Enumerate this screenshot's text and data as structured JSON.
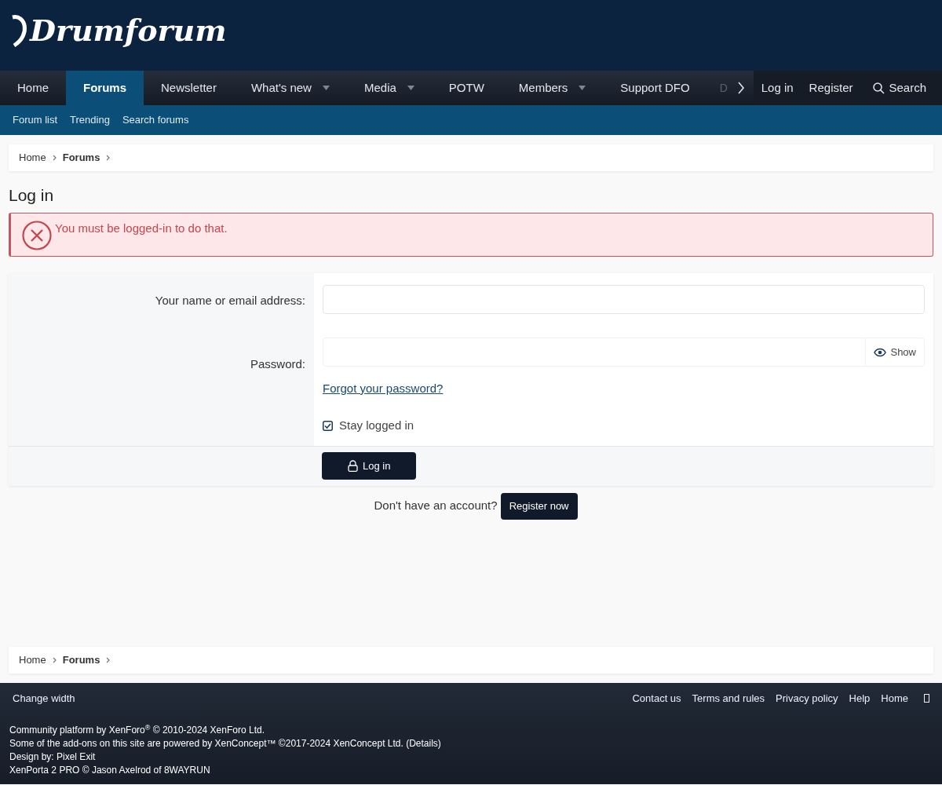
{
  "logo": {
    "text": "Drumforum"
  },
  "nav": {
    "tabs": [
      {
        "label": "Home",
        "selected": false,
        "dropdown": false
      },
      {
        "label": "Forums",
        "selected": true,
        "dropdown": false
      },
      {
        "label": "Newsletter",
        "selected": false,
        "dropdown": false
      },
      {
        "label": "What's new",
        "selected": false,
        "dropdown": true
      },
      {
        "label": "Media",
        "selected": false,
        "dropdown": true
      },
      {
        "label": "POTW",
        "selected": false,
        "dropdown": false
      },
      {
        "label": "Members",
        "selected": false,
        "dropdown": true
      },
      {
        "label": "Support DFO",
        "selected": false,
        "dropdown": false
      }
    ],
    "clipped_tab": "D",
    "account": [
      "Log in",
      "Register"
    ],
    "search": "Search"
  },
  "subnav": [
    "Forum list",
    "Trending",
    "Search forums"
  ],
  "breadcrumb_top": [
    {
      "label": "Home",
      "current": false
    },
    {
      "label": "Forums",
      "current": true
    }
  ],
  "page_title": "Log in",
  "error": "You must be logged-in to do that.",
  "form": {
    "fields": [
      {
        "label": "Your name or email address:",
        "kind": "text"
      },
      {
        "label": "Password:",
        "kind": "password",
        "toggle": "Show"
      }
    ],
    "forgot_link": "Forgot your password?",
    "stay_logged_in": {
      "label": "Stay logged in",
      "checked": true
    },
    "submit": "Log in"
  },
  "register": {
    "prompt": "Don't have an account?",
    "button": "Register now"
  },
  "breadcrumb_bottom": [
    {
      "label": "Home",
      "current": false
    },
    {
      "label": "Forums",
      "current": true
    }
  ],
  "footer": {
    "change_width": "Change width",
    "links": [
      "Contact us",
      "Terms and rules",
      "Privacy policy",
      "Help",
      "Home"
    ],
    "credits": [
      "Community platform by XenForo$^{®}$ © 2010-2024 XenForo Ltd.",
      "Some of the add-ons on this site are powered by XenConcept™ ©2017-2024 XenConcept Ltd. (Details)",
      "Design by: Pixel Exit",
      "XenPorta 2 PRO © Jason Axelrod of 8WAYRUN"
    ]
  }
}
